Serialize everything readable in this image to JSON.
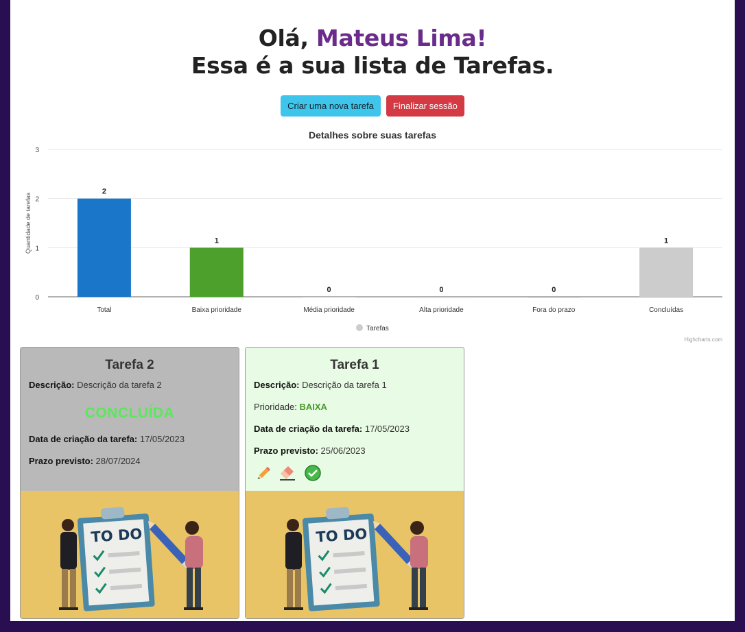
{
  "header": {
    "greeting_prefix": "Olá, ",
    "user_name": "Mateus Lima!",
    "subtitle": "Essa é a sua lista de Tarefas."
  },
  "buttons": {
    "new_task": "Criar uma nova tarefa",
    "logout": "Finalizar sessão"
  },
  "colors": {
    "background": "#2a0e52",
    "name_accent": "#6a2b8a",
    "info_button": "#3fc5eb",
    "danger_button": "#d33a44",
    "done_card": "#b9b9b9",
    "low_priority_card": "#e8fbe4",
    "image_bg": "#e8c466"
  },
  "chart_data": {
    "type": "bar",
    "title": "Detalhes sobre suas tarefas",
    "ylabel": "Quantidade de tarefas",
    "xlabel": "",
    "ylim": [
      0,
      3
    ],
    "yticks": [
      0,
      1,
      2,
      3
    ],
    "grid": true,
    "categories": [
      "Total",
      "Baixa prioridade",
      "Média prioridade",
      "Alta prioridade",
      "Fora do prazo",
      "Concluídas"
    ],
    "series": [
      {
        "name": "Tarefas",
        "values": [
          2,
          1,
          0,
          0,
          0,
          1
        ]
      }
    ],
    "bar_colors": [
      "#1976c8",
      "#4da02b",
      "#d9892a",
      "#d33a44",
      "#8a1a1a",
      "#cccccc"
    ],
    "legend_placement": "bottom",
    "credits": "Highcharts.com"
  },
  "cards": [
    {
      "title": "Tarefa 2",
      "description_label": "Descrição:",
      "description": "Descrição da tarefa 2",
      "status": "CONCLUÍDA",
      "created_label": "Data de criação da tarefa:",
      "created": "17/05/2023",
      "deadline_label": "Prazo previsto:",
      "deadline": "28/07/2024",
      "image_text": "TO DO"
    },
    {
      "title": "Tarefa 1",
      "description_label": "Descrição:",
      "description": "Descrição da tarefa 1",
      "priority_label": "Prioridade: ",
      "priority": "BAIXA",
      "created_label": "Data de criação da tarefa:",
      "created": "17/05/2023",
      "deadline_label": "Prazo previsto:",
      "deadline": "25/06/2023",
      "actions": [
        "pencil-icon",
        "eraser-icon",
        "check-circle-icon"
      ],
      "image_text": "TO DO"
    }
  ]
}
